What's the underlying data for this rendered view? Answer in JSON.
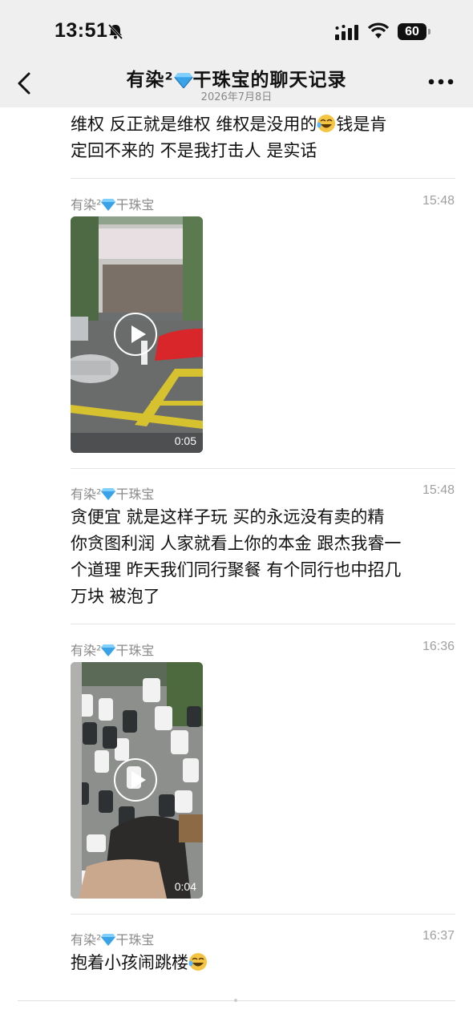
{
  "status": {
    "time": "13:51",
    "battery": "60"
  },
  "header": {
    "title": "有染²💎干珠宝的聊天记录",
    "title_prefix": "有染²",
    "title_suffix": "干珠宝的聊天记录",
    "date": "2026年7月8日"
  },
  "messages": [
    {
      "text_line1": "维权  反正就是维权   维权是没用的",
      "text_line1b": "钱是肯",
      "text_line2": "定回不来的   不是我打击人   是实话"
    },
    {
      "sender_prefix": "有染²",
      "sender_suffix": "干珠宝",
      "time": "15:48",
      "video_duration": "0:05"
    },
    {
      "sender_prefix": "有染²",
      "sender_suffix": "干珠宝",
      "time": "15:48",
      "lines": [
        "贪便宜 就是这样子玩   买的永远没有卖的精",
        "你贪图利润 人家就看上你的本金  跟杰我睿一",
        "个道理  昨天我们同行聚餐  有个同行也中招几",
        "万块  被泡了"
      ]
    },
    {
      "sender_prefix": "有染²",
      "sender_suffix": "干珠宝",
      "time": "16:36",
      "video_duration": "0:04"
    },
    {
      "sender_prefix": "有染²",
      "sender_suffix": "干珠宝",
      "time": "16:37",
      "text": "抱着小孩闹跳楼"
    }
  ],
  "icons": {
    "back": "chevron-left-icon",
    "more": "more-dots-icon",
    "gem": "gem-icon",
    "emoji": "laughing-tears-emoji-icon",
    "play": "play-icon"
  },
  "colors": {
    "header_bg": "#efefef",
    "gem": "#3aa3e8",
    "emoji": "#f5c443"
  }
}
